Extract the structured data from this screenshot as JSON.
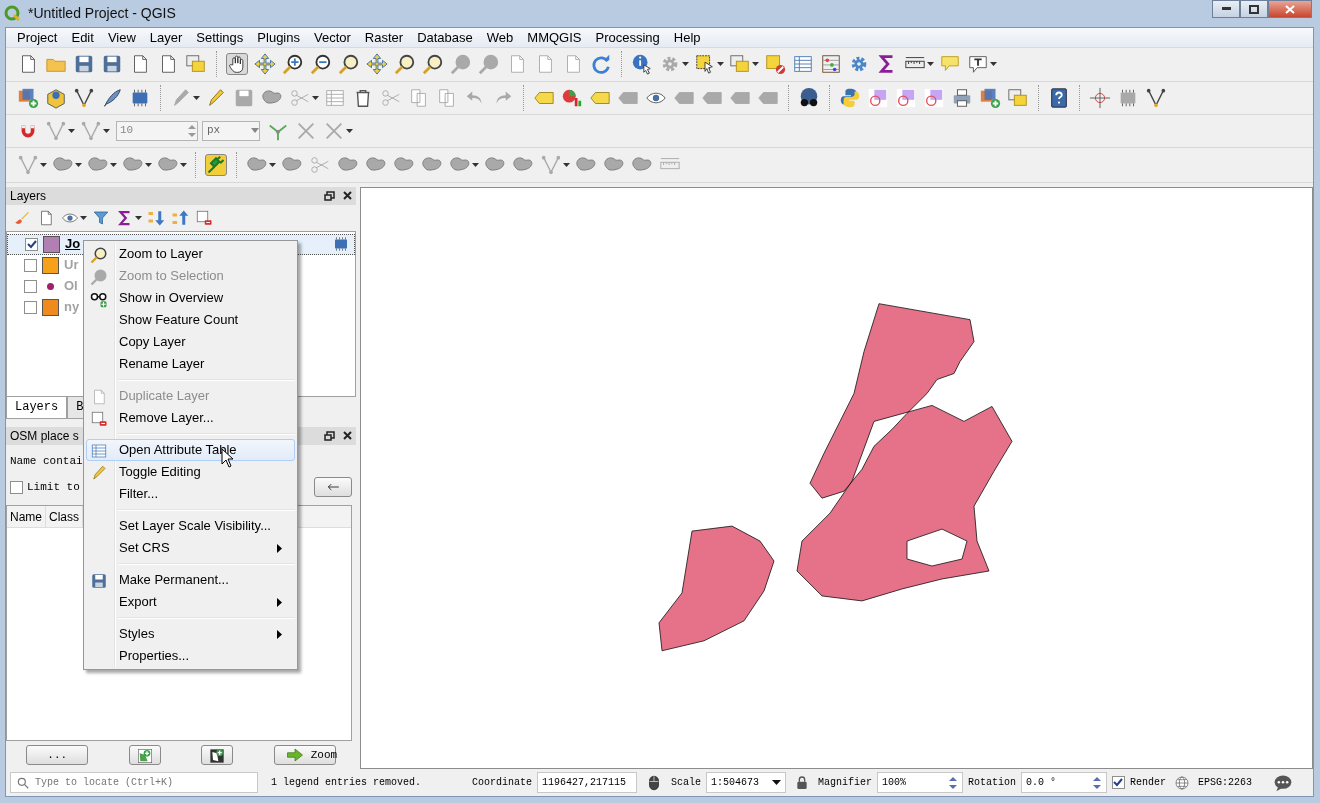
{
  "window": {
    "title": "*Untitled Project - QGIS"
  },
  "menu_bar": [
    {
      "label": "Project"
    },
    {
      "label": "Edit"
    },
    {
      "label": "View"
    },
    {
      "label": "Layer"
    },
    {
      "label": "Settings"
    },
    {
      "label": "Plugins"
    },
    {
      "label": "Vector"
    },
    {
      "label": "Raster"
    },
    {
      "label": "Database"
    },
    {
      "label": "Web"
    },
    {
      "label": "MMQGIS"
    },
    {
      "label": "Processing"
    },
    {
      "label": "Help"
    }
  ],
  "snapping_toolbar": {
    "tolerance": "10",
    "units": "px"
  },
  "layers_panel": {
    "title": "Layers",
    "layers": [
      {
        "name": "Jo",
        "checked": true,
        "selected": true,
        "temporary": true,
        "kind": "fill",
        "color": "#b27fb2"
      },
      {
        "name": "Ur",
        "checked": false,
        "selected": false,
        "temporary": false,
        "kind": "fill",
        "color": "#f7a11a"
      },
      {
        "name": "Ol",
        "checked": false,
        "selected": false,
        "temporary": false,
        "kind": "point",
        "color": "#a0206a"
      },
      {
        "name": "ny",
        "checked": false,
        "selected": false,
        "temporary": false,
        "kind": "fill",
        "color": "#ef8b1c"
      }
    ]
  },
  "dock_tabs": [
    {
      "label": "Layers",
      "selected": true
    },
    {
      "label": "B",
      "selected": false
    }
  ],
  "osm_panel": {
    "title": "OSM place s",
    "name_label": "Name contai",
    "limit_label": "Limit to",
    "limit_checked": false,
    "columns": [
      "Name",
      "Class"
    ],
    "more_button": "...",
    "zoom_button": "Zoom"
  },
  "context_menu": {
    "items": [
      {
        "kind": "item",
        "label": "Zoom to Layer",
        "disabled": false,
        "selected": false,
        "submenu": false
      },
      {
        "kind": "item",
        "label": "Zoom to Selection",
        "disabled": true,
        "selected": false,
        "submenu": false
      },
      {
        "kind": "item",
        "label": "Show in Overview",
        "disabled": false,
        "selected": false,
        "submenu": false
      },
      {
        "kind": "item",
        "label": "Show Feature Count",
        "disabled": false,
        "selected": false,
        "submenu": false
      },
      {
        "kind": "item",
        "label": "Copy Layer",
        "disabled": false,
        "selected": false,
        "submenu": false
      },
      {
        "kind": "item",
        "label": "Rename Layer",
        "disabled": false,
        "selected": false,
        "submenu": false
      },
      {
        "kind": "separator"
      },
      {
        "kind": "item",
        "label": "Duplicate Layer",
        "disabled": true,
        "selected": false,
        "submenu": false
      },
      {
        "kind": "item",
        "label": "Remove Layer...",
        "disabled": false,
        "selected": false,
        "submenu": false
      },
      {
        "kind": "separator"
      },
      {
        "kind": "item",
        "label": "Open Attribute Table",
        "disabled": false,
        "selected": true,
        "submenu": false
      },
      {
        "kind": "item",
        "label": "Toggle Editing",
        "disabled": false,
        "selected": false,
        "submenu": false
      },
      {
        "kind": "item",
        "label": "Filter...",
        "disabled": false,
        "selected": false,
        "submenu": false
      },
      {
        "kind": "separator"
      },
      {
        "kind": "item",
        "label": "Set Layer Scale Visibility...",
        "disabled": false,
        "selected": false,
        "submenu": false
      },
      {
        "kind": "item",
        "label": "Set CRS",
        "disabled": false,
        "selected": false,
        "submenu": true
      },
      {
        "kind": "separator"
      },
      {
        "kind": "item",
        "label": "Make Permanent...",
        "disabled": false,
        "selected": false,
        "submenu": false
      },
      {
        "kind": "item",
        "label": "Export",
        "disabled": false,
        "selected": false,
        "submenu": true
      },
      {
        "kind": "separator"
      },
      {
        "kind": "item",
        "label": "Styles",
        "disabled": false,
        "selected": false,
        "submenu": true
      },
      {
        "kind": "item",
        "label": "Properties...",
        "disabled": false,
        "selected": false,
        "submenu": false
      }
    ]
  },
  "status_bar": {
    "locate_placeholder": "Type to locate (Ctrl+K)",
    "message": "1 legend entries removed.",
    "coordinate_label": "Coordinate",
    "coordinate": "1196427,217115",
    "scale_label": "Scale",
    "scale": "1:504673",
    "magnifier_label": "Magnifier",
    "magnifier": "100%",
    "rotation_label": "Rotation",
    "rotation": "0.0 °",
    "render_label": "Render",
    "render_checked": true,
    "crs": "EPSG:2263"
  }
}
